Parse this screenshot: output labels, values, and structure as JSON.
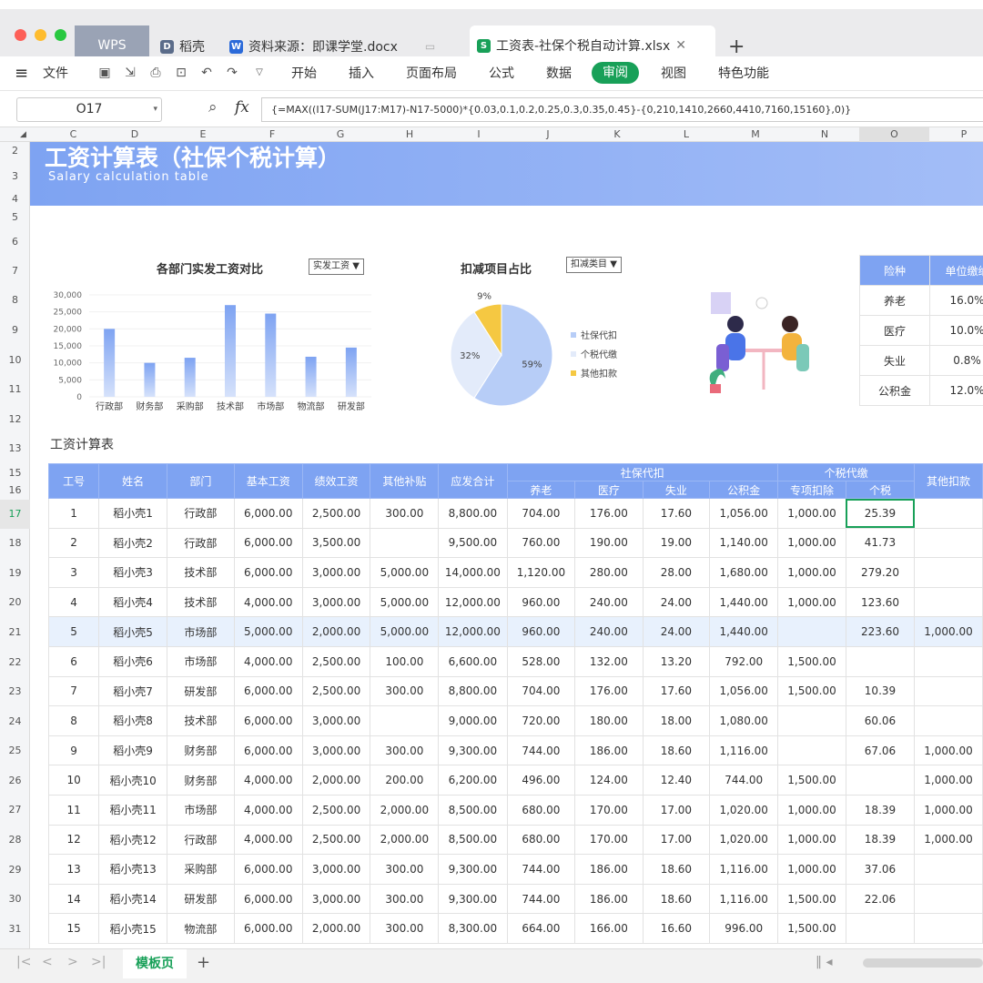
{
  "titlebar": {
    "tabs": [
      {
        "label": "WPS"
      },
      {
        "label": "稻壳"
      },
      {
        "label": "资料来源：即课学堂.docx"
      },
      {
        "label": "工资表-社保个税自动计算.xlsx"
      }
    ],
    "new_tab_icon": "plus-icon"
  },
  "menubar": {
    "file": "文件",
    "items": [
      "开始",
      "插入",
      "页面布局",
      "公式",
      "数据",
      "审阅",
      "视图",
      "特色功能"
    ],
    "active": "审阅",
    "accent": "#18a058"
  },
  "formulabar": {
    "cellref": "O17",
    "fx": "fx",
    "formula": "{=MAX((I17-SUM(J17:M17)-N17-5000)*{0.03,0.1,0.2,0.25,0.3,0.35,0.45}-{0,210,1410,2660,4410,7160,15160},0)}"
  },
  "columns": [
    "C",
    "D",
    "E",
    "F",
    "G",
    "H",
    "I",
    "J",
    "K",
    "L",
    "M",
    "N",
    "O",
    "P"
  ],
  "rows": [
    "2",
    "3",
    "4",
    "5",
    "6",
    "7",
    "8",
    "9",
    "10",
    "11",
    "12",
    "13",
    "15",
    "16",
    "17",
    "18",
    "19",
    "20",
    "21",
    "22",
    "23",
    "24",
    "25",
    "26",
    "27",
    "28",
    "29",
    "30",
    "31"
  ],
  "banner": {
    "title": "工资计算表（社保个税计算）",
    "subtitle": "Salary calculation table",
    "color": "#7ea3f2"
  },
  "chart_data": [
    {
      "type": "bar",
      "title": "各部门实发工资对比",
      "dropdown": "实发工资",
      "categories": [
        "行政部",
        "财务部",
        "采购部",
        "技术部",
        "市场部",
        "物流部",
        "研发部"
      ],
      "values": [
        20000,
        10000,
        11500,
        27000,
        24500,
        11800,
        14500
      ],
      "yticks": [
        "30,000",
        "25,000",
        "20,000",
        "15,000",
        "10,000",
        "5,000",
        "0"
      ],
      "ylim": [
        0,
        30000
      ]
    },
    {
      "type": "pie",
      "title": "扣减项目占比",
      "dropdown": "扣减类目",
      "slices": [
        {
          "name": "社保代扣",
          "value": 59,
          "label": "59%",
          "color": "#b7cdf7"
        },
        {
          "name": "个税代缴",
          "value": 32,
          "label": "32%",
          "color": "#e3ebfa"
        },
        {
          "name": "其他扣款",
          "value": 9,
          "label": "9%",
          "color": "#f5c842"
        }
      ]
    }
  ],
  "insurance": {
    "headers": [
      "险种",
      "单位缴纳"
    ],
    "rows": [
      [
        "养老",
        "16.0%"
      ],
      [
        "医疗",
        "10.0%"
      ],
      [
        "失业",
        "0.8%"
      ],
      [
        "公积金",
        "12.0%"
      ]
    ]
  },
  "table": {
    "title": "工资计算表",
    "headers": {
      "id": "工号",
      "name": "姓名",
      "dept": "部门",
      "base": "基本工资",
      "perf": "绩效工资",
      "other": "其他补贴",
      "gross": "应发合计",
      "social": "社保代扣",
      "pension": "养老",
      "medical": "医疗",
      "unemp": "失业",
      "fund": "公积金",
      "tax": "个税代缴",
      "special": "专项扣除",
      "iit": "个税",
      "otherded": "其他扣款"
    },
    "rows": [
      [
        "1",
        "稻小壳1",
        "行政部",
        "6,000.00",
        "2,500.00",
        "300.00",
        "8,800.00",
        "704.00",
        "176.00",
        "17.60",
        "1,056.00",
        "1,000.00",
        "25.39",
        ""
      ],
      [
        "2",
        "稻小壳2",
        "行政部",
        "6,000.00",
        "3,500.00",
        "",
        "9,500.00",
        "760.00",
        "190.00",
        "19.00",
        "1,140.00",
        "1,000.00",
        "41.73",
        ""
      ],
      [
        "3",
        "稻小壳3",
        "技术部",
        "6,000.00",
        "3,000.00",
        "5,000.00",
        "14,000.00",
        "1,120.00",
        "280.00",
        "28.00",
        "1,680.00",
        "1,000.00",
        "279.20",
        ""
      ],
      [
        "4",
        "稻小壳4",
        "技术部",
        "4,000.00",
        "3,000.00",
        "5,000.00",
        "12,000.00",
        "960.00",
        "240.00",
        "24.00",
        "1,440.00",
        "1,000.00",
        "123.60",
        ""
      ],
      [
        "5",
        "稻小壳5",
        "市场部",
        "5,000.00",
        "2,000.00",
        "5,000.00",
        "12,000.00",
        "960.00",
        "240.00",
        "24.00",
        "1,440.00",
        "",
        "223.60",
        "1,000.00"
      ],
      [
        "6",
        "稻小壳6",
        "市场部",
        "4,000.00",
        "2,500.00",
        "100.00",
        "6,600.00",
        "528.00",
        "132.00",
        "13.20",
        "792.00",
        "1,500.00",
        "",
        ""
      ],
      [
        "7",
        "稻小壳7",
        "研发部",
        "6,000.00",
        "2,500.00",
        "300.00",
        "8,800.00",
        "704.00",
        "176.00",
        "17.60",
        "1,056.00",
        "1,500.00",
        "10.39",
        ""
      ],
      [
        "8",
        "稻小壳8",
        "技术部",
        "6,000.00",
        "3,000.00",
        "",
        "9,000.00",
        "720.00",
        "180.00",
        "18.00",
        "1,080.00",
        "",
        "60.06",
        ""
      ],
      [
        "9",
        "稻小壳9",
        "财务部",
        "6,000.00",
        "3,000.00",
        "300.00",
        "9,300.00",
        "744.00",
        "186.00",
        "18.60",
        "1,116.00",
        "",
        "67.06",
        "1,000.00"
      ],
      [
        "10",
        "稻小壳10",
        "财务部",
        "4,000.00",
        "2,000.00",
        "200.00",
        "6,200.00",
        "496.00",
        "124.00",
        "12.40",
        "744.00",
        "1,500.00",
        "",
        "1,000.00"
      ],
      [
        "11",
        "稻小壳11",
        "市场部",
        "4,000.00",
        "2,500.00",
        "2,000.00",
        "8,500.00",
        "680.00",
        "170.00",
        "17.00",
        "1,020.00",
        "1,000.00",
        "18.39",
        "1,000.00"
      ],
      [
        "12",
        "稻小壳12",
        "行政部",
        "4,000.00",
        "2,500.00",
        "2,000.00",
        "8,500.00",
        "680.00",
        "170.00",
        "17.00",
        "1,020.00",
        "1,000.00",
        "18.39",
        "1,000.00"
      ],
      [
        "13",
        "稻小壳13",
        "采购部",
        "6,000.00",
        "3,000.00",
        "300.00",
        "9,300.00",
        "744.00",
        "186.00",
        "18.60",
        "1,116.00",
        "1,000.00",
        "37.06",
        ""
      ],
      [
        "14",
        "稻小壳14",
        "研发部",
        "6,000.00",
        "3,000.00",
        "300.00",
        "9,300.00",
        "744.00",
        "186.00",
        "18.60",
        "1,116.00",
        "1,500.00",
        "22.06",
        ""
      ],
      [
        "15",
        "稻小壳15",
        "物流部",
        "6,000.00",
        "2,000.00",
        "300.00",
        "8,300.00",
        "664.00",
        "166.00",
        "16.60",
        "996.00",
        "1,500.00",
        "",
        ""
      ]
    ]
  },
  "sheet": {
    "tab": "模板页"
  }
}
